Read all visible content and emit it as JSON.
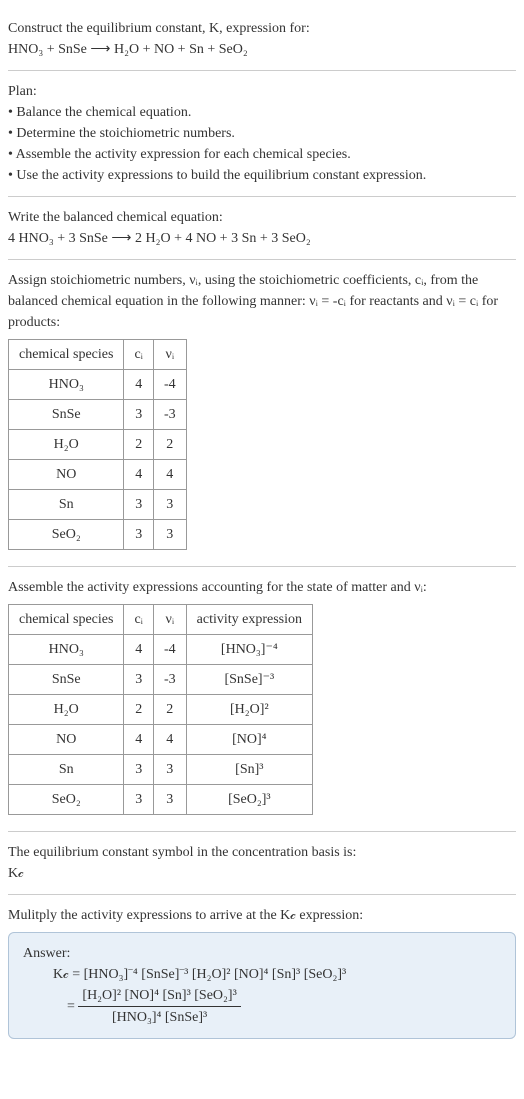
{
  "header": {
    "title": "Construct the equilibrium constant, K, expression for:",
    "equation": "HNO₃ + SnSe ⟶ H₂O + NO + Sn + SeO₂"
  },
  "plan": {
    "title": "Plan:",
    "items": [
      "• Balance the chemical equation.",
      "• Determine the stoichiometric numbers.",
      "• Assemble the activity expression for each chemical species.",
      "• Use the activity expressions to build the equilibrium constant expression."
    ]
  },
  "balanced": {
    "title": "Write the balanced chemical equation:",
    "equation": "4 HNO₃ + 3 SnSe ⟶ 2 H₂O + 4 NO + 3 Sn + 3 SeO₂"
  },
  "stoich": {
    "intro": "Assign stoichiometric numbers, νᵢ, using the stoichiometric coefficients, cᵢ, from the balanced chemical equation in the following manner: νᵢ = -cᵢ for reactants and νᵢ = cᵢ for products:",
    "headers": [
      "chemical species",
      "cᵢ",
      "νᵢ"
    ],
    "rows": [
      {
        "species": "HNO₃",
        "c": "4",
        "v": "-4"
      },
      {
        "species": "SnSe",
        "c": "3",
        "v": "-3"
      },
      {
        "species": "H₂O",
        "c": "2",
        "v": "2"
      },
      {
        "species": "NO",
        "c": "4",
        "v": "4"
      },
      {
        "species": "Sn",
        "c": "3",
        "v": "3"
      },
      {
        "species": "SeO₂",
        "c": "3",
        "v": "3"
      }
    ]
  },
  "activity": {
    "intro": "Assemble the activity expressions accounting for the state of matter and νᵢ:",
    "headers": [
      "chemical species",
      "cᵢ",
      "νᵢ",
      "activity expression"
    ],
    "rows": [
      {
        "species": "HNO₃",
        "c": "4",
        "v": "-4",
        "expr": "[HNO₃]⁻⁴"
      },
      {
        "species": "SnSe",
        "c": "3",
        "v": "-3",
        "expr": "[SnSe]⁻³"
      },
      {
        "species": "H₂O",
        "c": "2",
        "v": "2",
        "expr": "[H₂O]²"
      },
      {
        "species": "NO",
        "c": "4",
        "v": "4",
        "expr": "[NO]⁴"
      },
      {
        "species": "Sn",
        "c": "3",
        "v": "3",
        "expr": "[Sn]³"
      },
      {
        "species": "SeO₂",
        "c": "3",
        "v": "3",
        "expr": "[SeO₂]³"
      }
    ]
  },
  "symbol": {
    "line1": "The equilibrium constant symbol in the concentration basis is:",
    "line2": "K𝒸"
  },
  "multiply": {
    "title": "Mulitply the activity expressions to arrive at the K𝒸 expression:"
  },
  "answer": {
    "label": "Answer:",
    "line1": "K𝒸 = [HNO₃]⁻⁴ [SnSe]⁻³ [H₂O]² [NO]⁴ [Sn]³ [SeO₂]³",
    "eq": "=",
    "num": "[H₂O]² [NO]⁴ [Sn]³ [SeO₂]³",
    "den": "[HNO₃]⁴ [SnSe]³"
  }
}
